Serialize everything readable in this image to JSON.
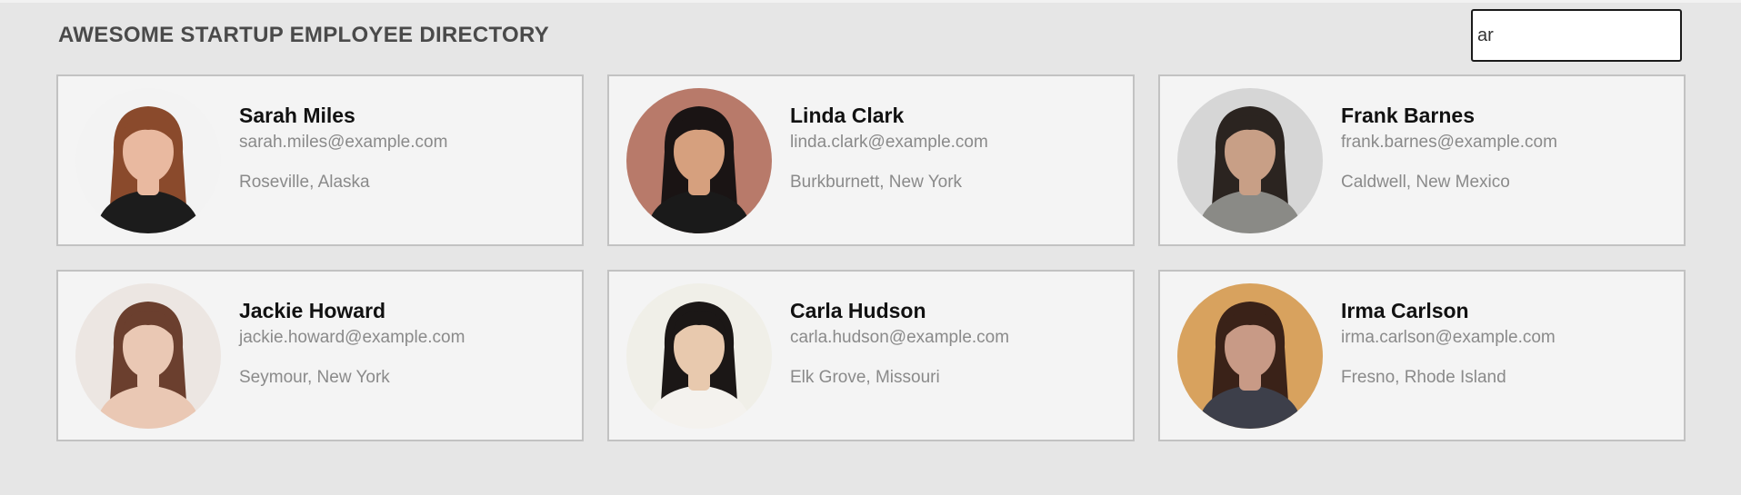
{
  "header": {
    "title": "AWESOME STARTUP EMPLOYEE DIRECTORY",
    "search_value": "ar"
  },
  "employees": [
    {
      "name": "Sarah Miles",
      "email": "sarah.miles@example.com",
      "location": "Roseville, Alaska",
      "avatar": {
        "bg": "#f3f3f3",
        "skin": "#e9b9a0",
        "hair": "#8a4a2c",
        "clothes": "#1c1c1c"
      }
    },
    {
      "name": "Linda Clark",
      "email": "linda.clark@example.com",
      "location": "Burkburnett, New York",
      "avatar": {
        "bg": "#b87a6a",
        "skin": "#d6a07e",
        "hair": "#1a1414",
        "clothes": "#1a1a1a"
      }
    },
    {
      "name": "Frank Barnes",
      "email": "frank.barnes@example.com",
      "location": "Caldwell, New Mexico",
      "avatar": {
        "bg": "#d6d6d6",
        "skin": "#c89f86",
        "hair": "#2b2420",
        "clothes": "#8a8a86"
      }
    },
    {
      "name": "Jackie Howard",
      "email": "jackie.howard@example.com",
      "location": "Seymour, New York",
      "avatar": {
        "bg": "#ece6e2",
        "skin": "#eac8b4",
        "hair": "#6b3f2e",
        "clothes": "#eac8b4"
      }
    },
    {
      "name": "Carla Hudson",
      "email": "carla.hudson@example.com",
      "location": "Elk Grove, Missouri",
      "avatar": {
        "bg": "#f0efe8",
        "skin": "#e8c9ae",
        "hair": "#1b1716",
        "clothes": "#f4f2ee"
      }
    },
    {
      "name": "Irma Carlson",
      "email": "irma.carlson@example.com",
      "location": "Fresno, Rhode Island",
      "avatar": {
        "bg": "#d8a25e",
        "skin": "#c89a86",
        "hair": "#3a2218",
        "clothes": "#3d3f4a"
      }
    }
  ]
}
